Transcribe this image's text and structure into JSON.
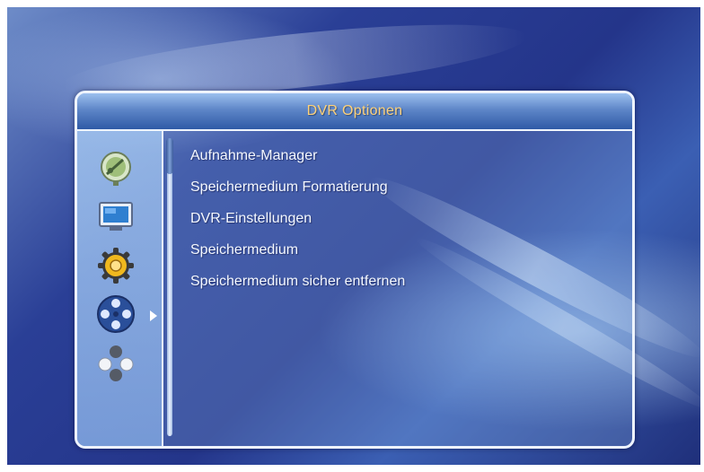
{
  "window": {
    "title": "DVR Optionen"
  },
  "menu": {
    "items": [
      "Aufnahme-Manager",
      "Speichermedium Formatierung",
      "DVR-Einstellungen",
      "Speichermedium",
      "Speichermedium sicher entfernen"
    ]
  },
  "sidebar": {
    "icons": [
      "satellite-dish-icon",
      "tv-monitor-icon",
      "settings-gear-icon",
      "film-reel-icon",
      "molecule-tools-icon"
    ],
    "selected_index": 3
  },
  "colors": {
    "title_text": "#ffd27a",
    "menu_text": "#f4f8ff",
    "frame_border": "#eef4ff"
  }
}
